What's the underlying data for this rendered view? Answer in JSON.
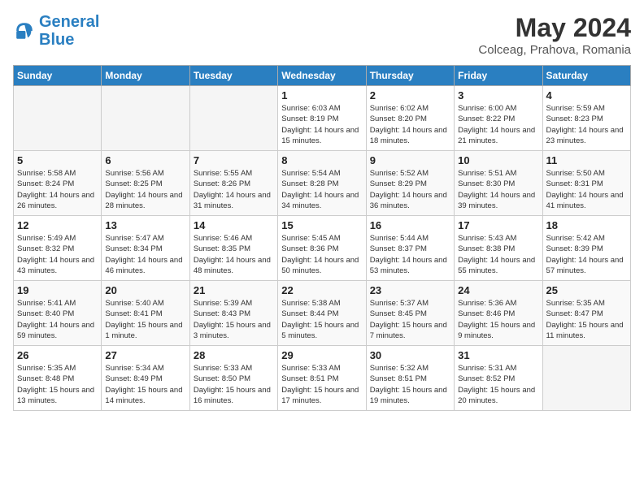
{
  "header": {
    "logo_line1": "General",
    "logo_line2": "Blue",
    "month_year": "May 2024",
    "location": "Colceag, Prahova, Romania"
  },
  "days_of_week": [
    "Sunday",
    "Monday",
    "Tuesday",
    "Wednesday",
    "Thursday",
    "Friday",
    "Saturday"
  ],
  "weeks": [
    [
      {
        "day": "",
        "sunrise": "",
        "sunset": "",
        "daylight": ""
      },
      {
        "day": "",
        "sunrise": "",
        "sunset": "",
        "daylight": ""
      },
      {
        "day": "",
        "sunrise": "",
        "sunset": "",
        "daylight": ""
      },
      {
        "day": "1",
        "sunrise": "Sunrise: 6:03 AM",
        "sunset": "Sunset: 8:19 PM",
        "daylight": "Daylight: 14 hours and 15 minutes."
      },
      {
        "day": "2",
        "sunrise": "Sunrise: 6:02 AM",
        "sunset": "Sunset: 8:20 PM",
        "daylight": "Daylight: 14 hours and 18 minutes."
      },
      {
        "day": "3",
        "sunrise": "Sunrise: 6:00 AM",
        "sunset": "Sunset: 8:22 PM",
        "daylight": "Daylight: 14 hours and 21 minutes."
      },
      {
        "day": "4",
        "sunrise": "Sunrise: 5:59 AM",
        "sunset": "Sunset: 8:23 PM",
        "daylight": "Daylight: 14 hours and 23 minutes."
      }
    ],
    [
      {
        "day": "5",
        "sunrise": "Sunrise: 5:58 AM",
        "sunset": "Sunset: 8:24 PM",
        "daylight": "Daylight: 14 hours and 26 minutes."
      },
      {
        "day": "6",
        "sunrise": "Sunrise: 5:56 AM",
        "sunset": "Sunset: 8:25 PM",
        "daylight": "Daylight: 14 hours and 28 minutes."
      },
      {
        "day": "7",
        "sunrise": "Sunrise: 5:55 AM",
        "sunset": "Sunset: 8:26 PM",
        "daylight": "Daylight: 14 hours and 31 minutes."
      },
      {
        "day": "8",
        "sunrise": "Sunrise: 5:54 AM",
        "sunset": "Sunset: 8:28 PM",
        "daylight": "Daylight: 14 hours and 34 minutes."
      },
      {
        "day": "9",
        "sunrise": "Sunrise: 5:52 AM",
        "sunset": "Sunset: 8:29 PM",
        "daylight": "Daylight: 14 hours and 36 minutes."
      },
      {
        "day": "10",
        "sunrise": "Sunrise: 5:51 AM",
        "sunset": "Sunset: 8:30 PM",
        "daylight": "Daylight: 14 hours and 39 minutes."
      },
      {
        "day": "11",
        "sunrise": "Sunrise: 5:50 AM",
        "sunset": "Sunset: 8:31 PM",
        "daylight": "Daylight: 14 hours and 41 minutes."
      }
    ],
    [
      {
        "day": "12",
        "sunrise": "Sunrise: 5:49 AM",
        "sunset": "Sunset: 8:32 PM",
        "daylight": "Daylight: 14 hours and 43 minutes."
      },
      {
        "day": "13",
        "sunrise": "Sunrise: 5:47 AM",
        "sunset": "Sunset: 8:34 PM",
        "daylight": "Daylight: 14 hours and 46 minutes."
      },
      {
        "day": "14",
        "sunrise": "Sunrise: 5:46 AM",
        "sunset": "Sunset: 8:35 PM",
        "daylight": "Daylight: 14 hours and 48 minutes."
      },
      {
        "day": "15",
        "sunrise": "Sunrise: 5:45 AM",
        "sunset": "Sunset: 8:36 PM",
        "daylight": "Daylight: 14 hours and 50 minutes."
      },
      {
        "day": "16",
        "sunrise": "Sunrise: 5:44 AM",
        "sunset": "Sunset: 8:37 PM",
        "daylight": "Daylight: 14 hours and 53 minutes."
      },
      {
        "day": "17",
        "sunrise": "Sunrise: 5:43 AM",
        "sunset": "Sunset: 8:38 PM",
        "daylight": "Daylight: 14 hours and 55 minutes."
      },
      {
        "day": "18",
        "sunrise": "Sunrise: 5:42 AM",
        "sunset": "Sunset: 8:39 PM",
        "daylight": "Daylight: 14 hours and 57 minutes."
      }
    ],
    [
      {
        "day": "19",
        "sunrise": "Sunrise: 5:41 AM",
        "sunset": "Sunset: 8:40 PM",
        "daylight": "Daylight: 14 hours and 59 minutes."
      },
      {
        "day": "20",
        "sunrise": "Sunrise: 5:40 AM",
        "sunset": "Sunset: 8:41 PM",
        "daylight": "Daylight: 15 hours and 1 minute."
      },
      {
        "day": "21",
        "sunrise": "Sunrise: 5:39 AM",
        "sunset": "Sunset: 8:43 PM",
        "daylight": "Daylight: 15 hours and 3 minutes."
      },
      {
        "day": "22",
        "sunrise": "Sunrise: 5:38 AM",
        "sunset": "Sunset: 8:44 PM",
        "daylight": "Daylight: 15 hours and 5 minutes."
      },
      {
        "day": "23",
        "sunrise": "Sunrise: 5:37 AM",
        "sunset": "Sunset: 8:45 PM",
        "daylight": "Daylight: 15 hours and 7 minutes."
      },
      {
        "day": "24",
        "sunrise": "Sunrise: 5:36 AM",
        "sunset": "Sunset: 8:46 PM",
        "daylight": "Daylight: 15 hours and 9 minutes."
      },
      {
        "day": "25",
        "sunrise": "Sunrise: 5:35 AM",
        "sunset": "Sunset: 8:47 PM",
        "daylight": "Daylight: 15 hours and 11 minutes."
      }
    ],
    [
      {
        "day": "26",
        "sunrise": "Sunrise: 5:35 AM",
        "sunset": "Sunset: 8:48 PM",
        "daylight": "Daylight: 15 hours and 13 minutes."
      },
      {
        "day": "27",
        "sunrise": "Sunrise: 5:34 AM",
        "sunset": "Sunset: 8:49 PM",
        "daylight": "Daylight: 15 hours and 14 minutes."
      },
      {
        "day": "28",
        "sunrise": "Sunrise: 5:33 AM",
        "sunset": "Sunset: 8:50 PM",
        "daylight": "Daylight: 15 hours and 16 minutes."
      },
      {
        "day": "29",
        "sunrise": "Sunrise: 5:33 AM",
        "sunset": "Sunset: 8:51 PM",
        "daylight": "Daylight: 15 hours and 17 minutes."
      },
      {
        "day": "30",
        "sunrise": "Sunrise: 5:32 AM",
        "sunset": "Sunset: 8:51 PM",
        "daylight": "Daylight: 15 hours and 19 minutes."
      },
      {
        "day": "31",
        "sunrise": "Sunrise: 5:31 AM",
        "sunset": "Sunset: 8:52 PM",
        "daylight": "Daylight: 15 hours and 20 minutes."
      },
      {
        "day": "",
        "sunrise": "",
        "sunset": "",
        "daylight": ""
      }
    ]
  ]
}
